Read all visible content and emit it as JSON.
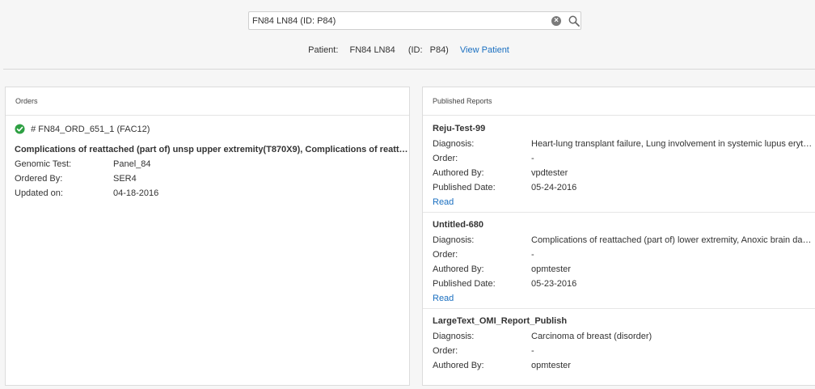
{
  "search": {
    "value": "FN84 LN84 (ID: P84)"
  },
  "patient": {
    "label": "Patient:",
    "name": "FN84 LN84",
    "id_label": "(ID:",
    "id_value": "P84)",
    "view_link": "View Patient"
  },
  "orders": {
    "header": "Orders",
    "order": {
      "id": "# FN84_ORD_651_1",
      "facility": "(FAC12)",
      "diagnosis": "Complications of reattached (part of) unsp upper extremity(T870X9), Complications of reattached (part of) lower extremity",
      "fields": [
        {
          "label": "Genomic Test:",
          "value": "Panel_84"
        },
        {
          "label": "Ordered By:",
          "value": "SER4"
        },
        {
          "label": "Updated on:",
          "value": "04-18-2016"
        }
      ]
    }
  },
  "reports": {
    "header": "Published Reports",
    "items": [
      {
        "title": "Reju-Test-99",
        "diagnosis": "Heart-lung transplant failure, Lung involvement in systemic lupus erythematosus",
        "order": "-",
        "authored_by": "vpdtester",
        "published_date": "05-24-2016",
        "read": "Read"
      },
      {
        "title": "Untitled-680",
        "diagnosis": "Complications of reattached (part of) lower extremity, Anoxic brain damage",
        "order": "-",
        "authored_by": "opmtester",
        "published_date": "05-23-2016",
        "read": "Read"
      },
      {
        "title": "LargeText_OMI_Report_Publish",
        "diagnosis": "Carcinoma of breast (disorder)",
        "order": "-",
        "authored_by": "opmtester"
      }
    ],
    "labels": {
      "diagnosis": "Diagnosis:",
      "order": "Order:",
      "authored_by": "Authored By:",
      "published_date": "Published Date:"
    }
  },
  "colors": {
    "link": "#1a6fc0",
    "success": "#2ea043"
  }
}
